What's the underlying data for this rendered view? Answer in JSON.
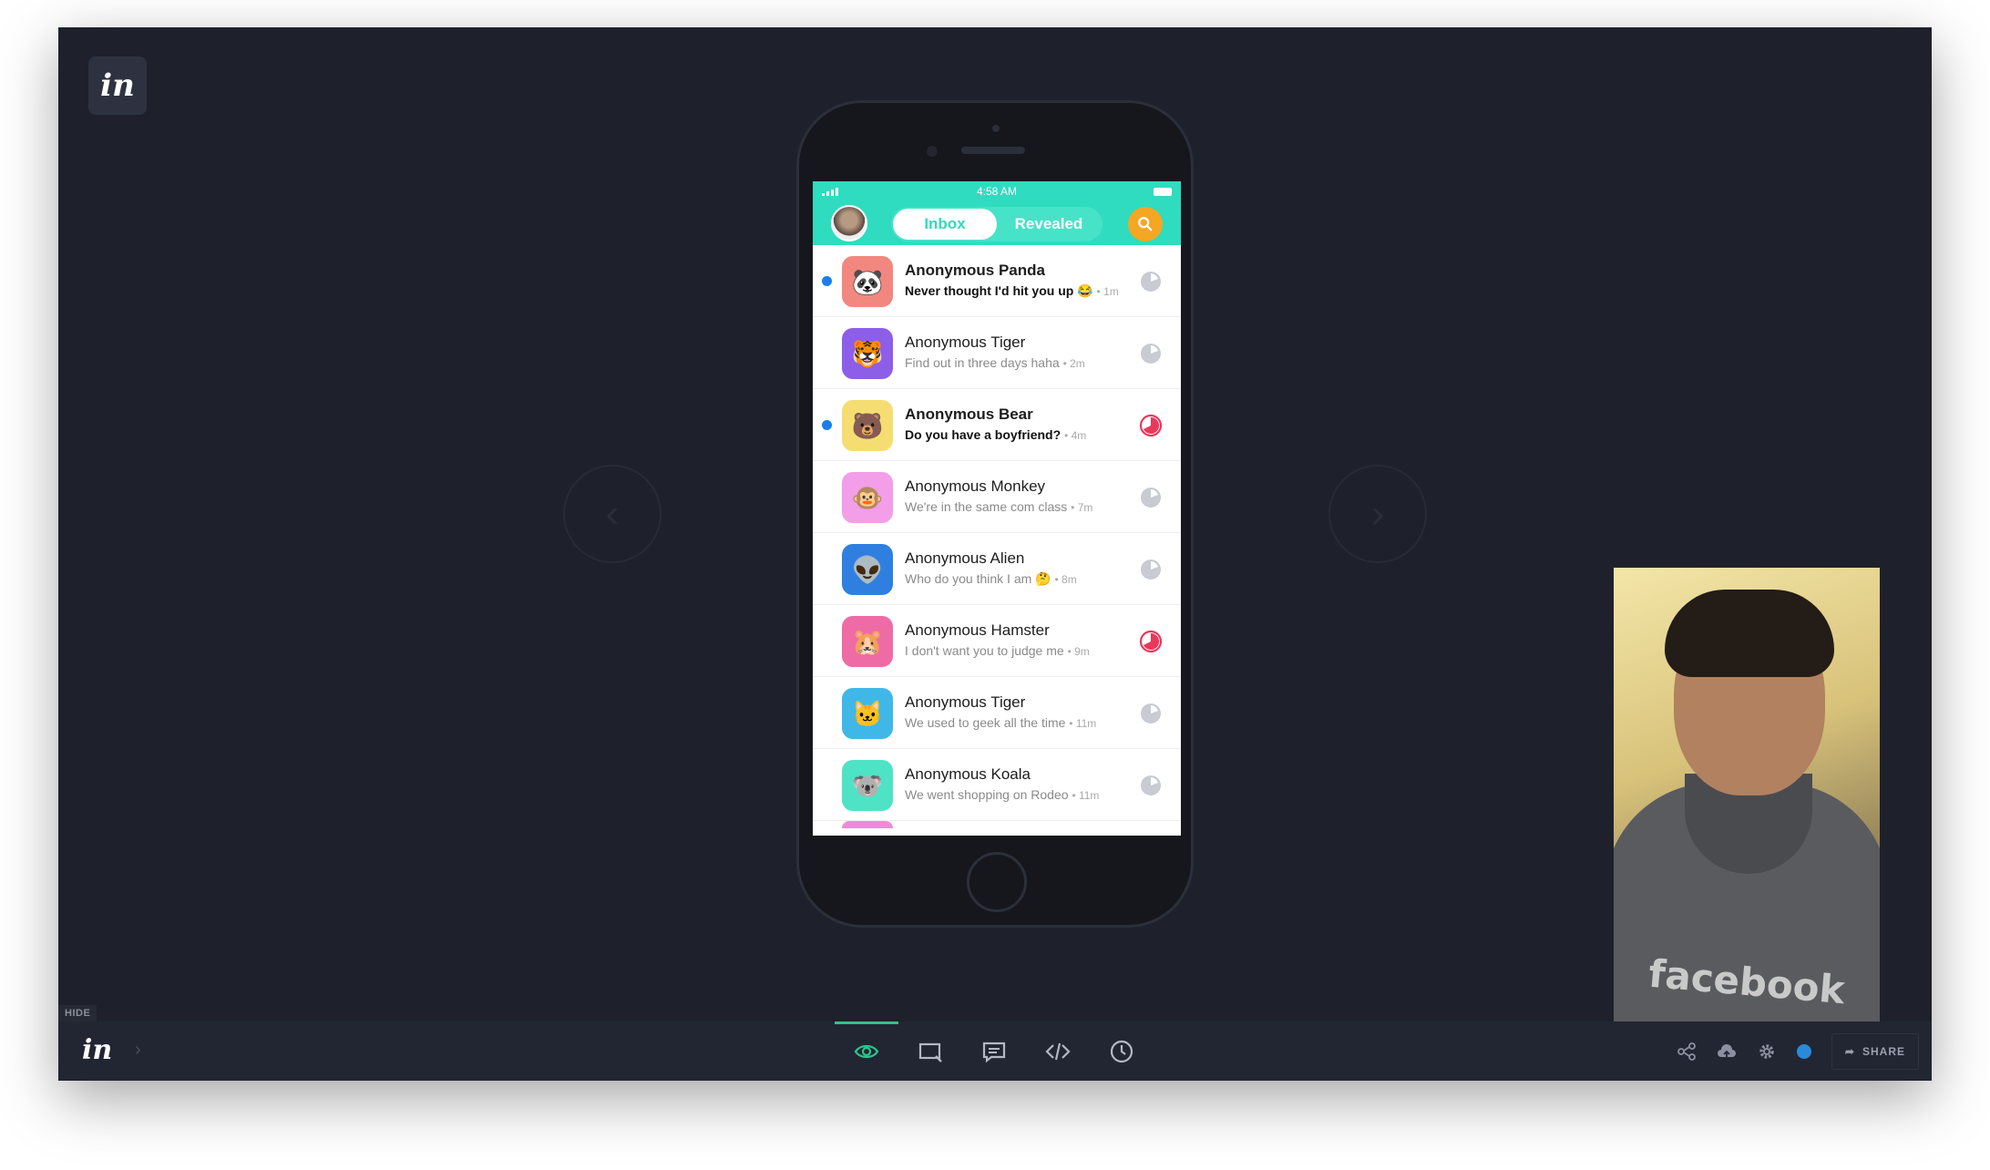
{
  "app": {
    "logo_text": "in",
    "hide_label": "HIDE"
  },
  "navigation": {
    "prev_icon": "chevron-left-icon",
    "next_icon": "chevron-right-icon"
  },
  "phone_screen": {
    "status_time": "4:58 AM",
    "tabs": [
      {
        "label": "Inbox",
        "active": true
      },
      {
        "label": "Revealed",
        "active": false
      }
    ],
    "accent_color": "#2fdcbf",
    "conversations": [
      {
        "name": "Anonymous Panda",
        "message": "Never thought I'd hit you up 😂",
        "time": "• 1m",
        "unread": true,
        "icon": "🐼",
        "color": "#f2877f",
        "timer": "grey"
      },
      {
        "name": "Anonymous Tiger",
        "message": "Find out in three days haha",
        "time": "• 2m",
        "unread": false,
        "icon": "🐯",
        "color": "#8d5ee8",
        "timer": "grey"
      },
      {
        "name": "Anonymous Bear",
        "message": "Do you have a boyfriend?",
        "time": "• 4m",
        "unread": true,
        "icon": "🐻",
        "color": "#f6dd72",
        "timer": "red"
      },
      {
        "name": "Anonymous Monkey",
        "message": "We're in the same com class",
        "time": "• 7m",
        "unread": false,
        "icon": "🐵",
        "color": "#f29ee8",
        "timer": "grey"
      },
      {
        "name": "Anonymous Alien",
        "message": "Who do you think I am 🤔",
        "time": "• 8m",
        "unread": false,
        "icon": "👽",
        "color": "#2f7fe0",
        "timer": "grey"
      },
      {
        "name": "Anonymous Hamster",
        "message": "I don't want you to judge me",
        "time": "• 9m",
        "unread": false,
        "icon": "🐹",
        "color": "#ef6ba5",
        "timer": "red"
      },
      {
        "name": "Anonymous Tiger",
        "message": "We used to geek all the time",
        "time": "• 11m",
        "unread": false,
        "icon": "🐱",
        "color": "#3fb8e8",
        "timer": "grey"
      },
      {
        "name": "Anonymous Koala",
        "message": "We went shopping on Rodeo",
        "time": "• 11m",
        "unread": false,
        "icon": "🐨",
        "color": "#4fe3c6",
        "timer": "grey"
      }
    ]
  },
  "webcam": {
    "shirt_text": "facebook"
  },
  "toolbar": {
    "tools": [
      {
        "name": "preview-mode-button",
        "icon": "eye-icon",
        "active": true
      },
      {
        "name": "build-mode-button",
        "icon": "screen-select-icon",
        "active": false
      },
      {
        "name": "comment-mode-button",
        "icon": "comment-icon",
        "active": false
      },
      {
        "name": "inspect-mode-button",
        "icon": "code-icon",
        "active": false
      },
      {
        "name": "history-mode-button",
        "icon": "clock-icon",
        "active": false
      }
    ],
    "share_label": "SHARE",
    "active_color": "#2cc48b"
  }
}
